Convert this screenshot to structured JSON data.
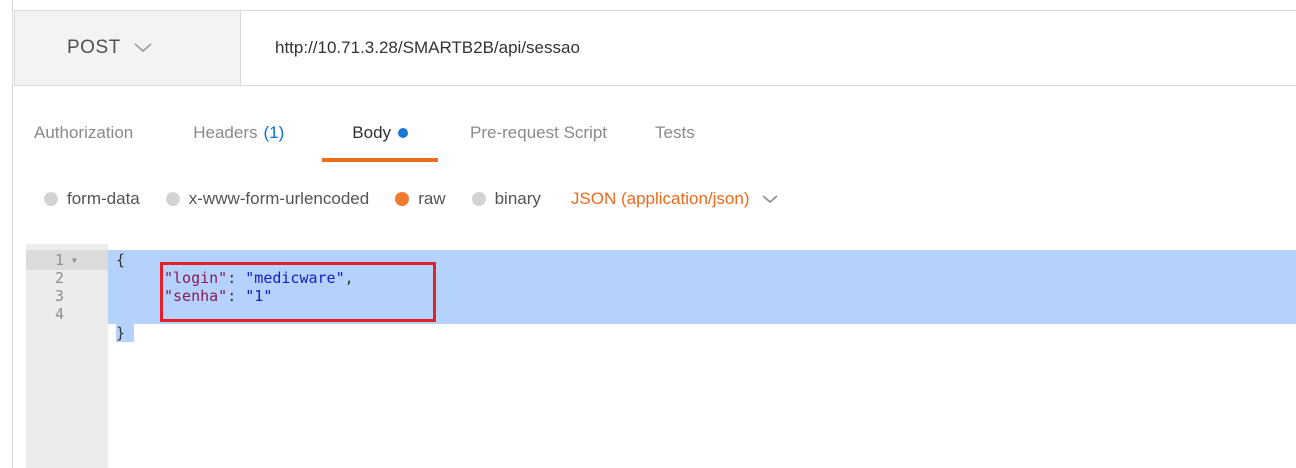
{
  "request": {
    "method": "POST",
    "url": "http://10.71.3.28/SMARTB2B/api/sessao"
  },
  "tabs": [
    {
      "label": "Authorization"
    },
    {
      "label": "Headers",
      "count": "(1)"
    },
    {
      "label": "Body",
      "active": true,
      "has_dot": true
    },
    {
      "label": "Pre-request Script"
    },
    {
      "label": "Tests"
    }
  ],
  "body_types": {
    "options": [
      "form-data",
      "x-www-form-urlencoded",
      "raw",
      "binary"
    ],
    "selected": "raw",
    "content_type": "JSON (application/json)"
  },
  "editor": {
    "line_numbers": [
      "1",
      "2",
      "3",
      "4"
    ],
    "lines": [
      {
        "open": "{"
      },
      {
        "key": "\"login\"",
        "sep": ": ",
        "value": "\"medicware\"",
        "end": ","
      },
      {
        "key": "\"senha\"",
        "sep": ": ",
        "value": "\"1\"",
        "end": ""
      },
      {
        "close": "}"
      }
    ]
  },
  "colors": {
    "accent": "#ef6a1a",
    "highlight_box": "#e3202a",
    "selection": "#b4d2fb",
    "headers_count": "#0c6ed1"
  },
  "icons": {
    "method_dropdown": "chevron-down-icon",
    "content_type_dropdown": "chevron-down-icon",
    "fold": "fold-arrow-icon",
    "body_dot": "unsaved-dot-icon"
  }
}
